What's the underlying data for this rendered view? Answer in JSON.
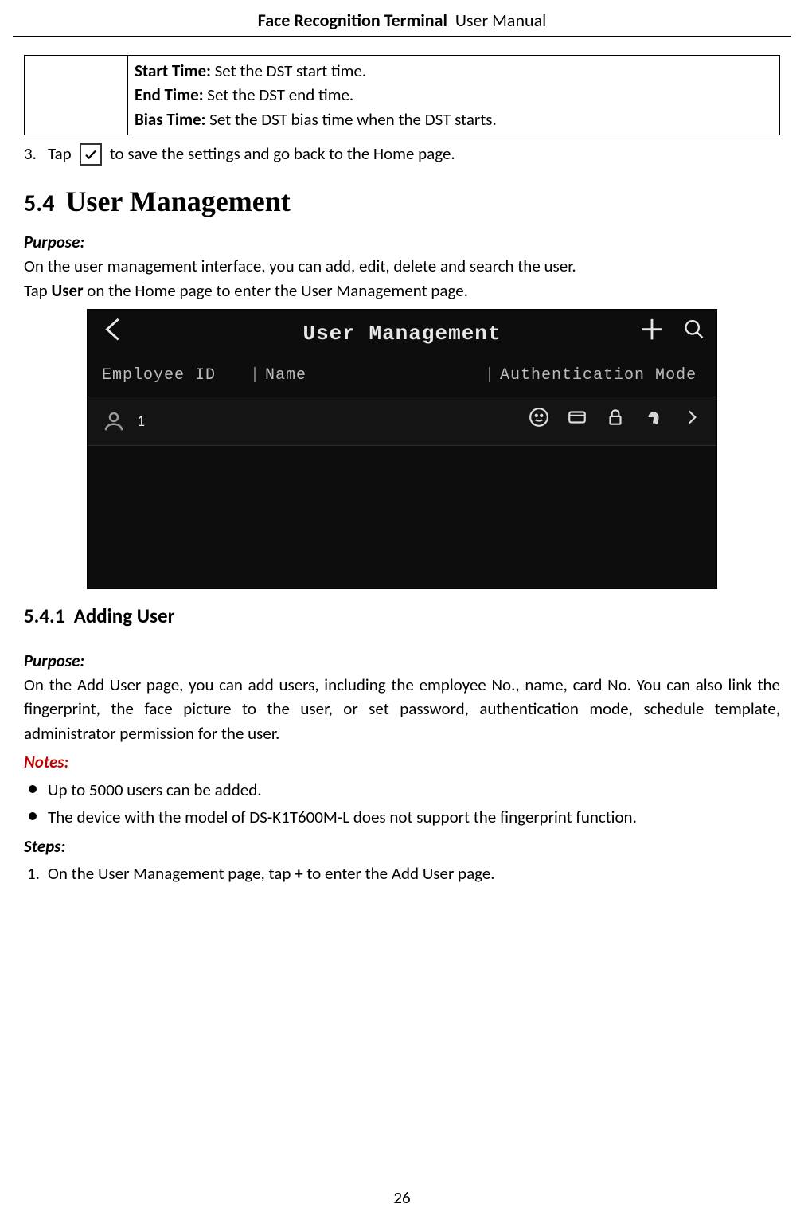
{
  "header": {
    "bold": "Face Recognition Terminal",
    "light": "User Manual"
  },
  "dst_rows": [
    {
      "label": "Start Time:",
      "desc": " Set the DST start time."
    },
    {
      "label": "End Time:",
      "desc": " Set the DST end time."
    },
    {
      "label": "Bias Time:",
      "desc": " Set the DST bias time when the DST starts."
    }
  ],
  "step3": {
    "num": "3.",
    "pre": "Tap ",
    "post": " to save the settings and go back to the Home page."
  },
  "section": {
    "num": "5.4",
    "title": "User Management"
  },
  "purpose_label": "Purpose:",
  "purpose_text": "On the user management interface, you can add, edit, delete and search the user.",
  "tap_line": {
    "pre": "Tap ",
    "bold": "User",
    "post": " on the Home page to enter the User Management page."
  },
  "device": {
    "title": "User Management",
    "headers": {
      "col1": "Employee ID",
      "col2": "Name",
      "col3": "Authentication Mode"
    },
    "row": {
      "employee_id": "1"
    }
  },
  "subsection": {
    "num": "5.4.1",
    "title": "Adding User"
  },
  "sub_purpose_label": "Purpose:",
  "sub_purpose_text": "On the Add User page, you can add users, including the employee No., name, card No. You can also link the fingerprint, the face picture to the user, or set password, authentication mode, schedule template, administrator permission for the user.",
  "notes_label": "Notes:",
  "notes": [
    "Up to 5000 users can be added.",
    "The device with the model of DS-K1T600M-L does not support the fingerprint function."
  ],
  "steps_label": "Steps:",
  "steps": [
    {
      "num": "1.",
      "pre": "On the User Management page, tap ",
      "bold": "+",
      "post": " to enter the Add User page."
    }
  ],
  "page_number": "26"
}
